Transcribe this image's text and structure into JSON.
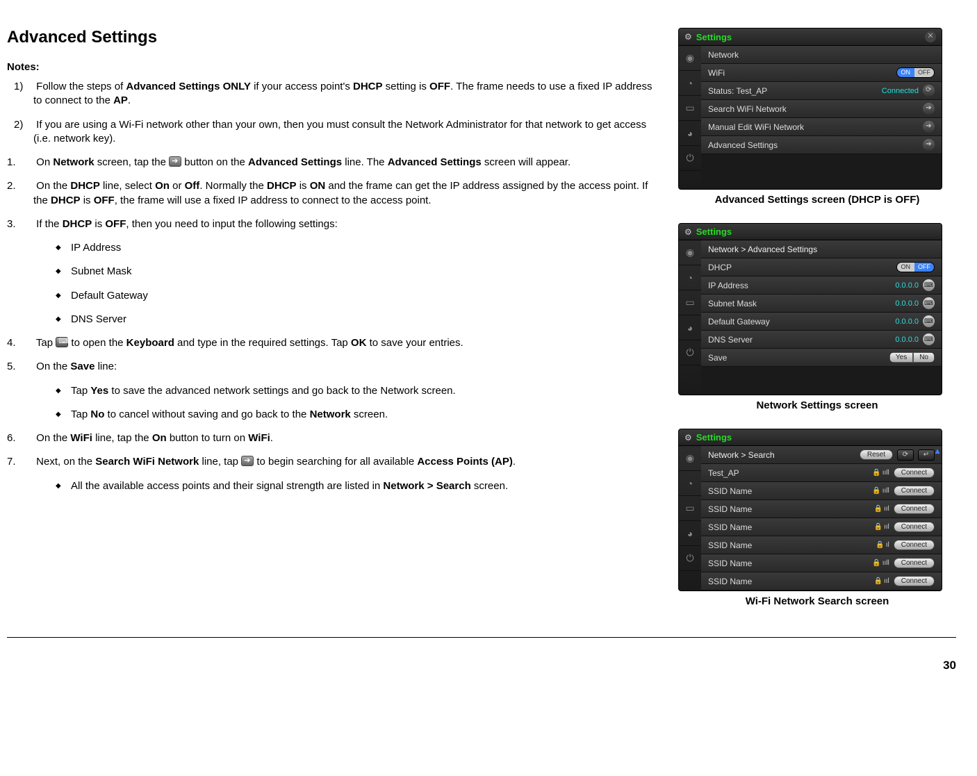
{
  "page": {
    "title": "Advanced Settings",
    "notes_label": "Notes:",
    "page_number": "30"
  },
  "notes": {
    "n1_num": "1)",
    "n1_a": "Follow the steps of ",
    "n1_b": "Advanced Settings ONLY",
    "n1_c": " if your access point's ",
    "n1_d": "DHCP",
    "n1_e": " setting is ",
    "n1_f": "OFF",
    "n1_g": ".  The frame needs to use a fixed IP address to connect to the ",
    "n1_h": "AP",
    "n1_i": ".",
    "n2_num": "2)",
    "n2": "If you are using a Wi-Fi network other than your own, then you must consult the Network Administrator for that network to get access (i.e. network key)."
  },
  "steps": {
    "s1_num": "1.",
    "s1_a": "On ",
    "s1_b": "Network",
    "s1_c": " screen, tap the  ",
    "s1_d": " button on the ",
    "s1_e": "Advanced Settings",
    "s1_f": " line.  The ",
    "s1_g": "Advanced Settings",
    "s1_h": " screen will appear.",
    "s2_num": "2.",
    "s2_a": "On the ",
    "s2_b": "DHCP",
    "s2_c": " line, select ",
    "s2_d": "On",
    "s2_e": " or ",
    "s2_f": "Off",
    "s2_g": ".  Normally the ",
    "s2_h": "DHCP",
    "s2_i": " is ",
    "s2_j": "ON",
    "s2_k": " and the frame can get the IP address assigned by the access point.  If the ",
    "s2_l": "DHCP",
    "s2_m": " is ",
    "s2_n": "OFF",
    "s2_o": ", the frame will use a fixed IP address to connect to the access point.",
    "s3_num": "3.",
    "s3_a": "If the ",
    "s3_b": "DHCP",
    "s3_c": " is ",
    "s3_d": "OFF",
    "s3_e": ", then you need to input the following settings:",
    "b1": "IP Address",
    "b2": "Subnet Mask",
    "b3": "Default Gateway",
    "b4": "DNS Server",
    "s4_num": "4.",
    "s4_a": "Tap ",
    "s4_b": " to open the ",
    "s4_c": "Keyboard",
    "s4_d": " and type in the required settings.  Tap ",
    "s4_e": "OK",
    "s4_f": " to save your entries.",
    "s5_num": "5.",
    "s5_a": "On the ",
    "s5_b": "Save",
    "s5_c": " line:",
    "b5_a": "Tap ",
    "b5_b": "Yes",
    "b5_c": " to save the advanced network settings and go back to the Network screen.",
    "b6_a": "Tap ",
    "b6_b": "No",
    "b6_c": " to cancel without saving and go back to the ",
    "b6_d": "Network",
    "b6_e": " screen.",
    "s6_num": "6.",
    "s6_a": "On the ",
    "s6_b": "WiFi",
    "s6_c": " line, tap the ",
    "s6_d": "On",
    "s6_e": " button to turn on ",
    "s6_f": "WiFi",
    "s6_g": ".",
    "s7_num": "7.",
    "s7_a": "Next, on the ",
    "s7_b": "Search WiFi Network",
    "s7_c": " line, tap ",
    "s7_d": " to begin searching for all available ",
    "s7_e": "Access Points (AP)",
    "s7_f": ".",
    "b7_a": "All the available access points and their signal strength are listed in ",
    "b7_b": "Network > Search",
    "b7_c": " screen."
  },
  "captions": {
    "c1": "Advanced Settings screen (DHCP is OFF)",
    "c2": "Network Settings screen",
    "c3": "Wi-Fi Network Search screen"
  },
  "dev_common": {
    "title": "Settings",
    "close": "✕"
  },
  "dev1": {
    "network_header": "Network",
    "wifi": "WiFi",
    "wifi_on": "ON",
    "wifi_off": "OFF",
    "status": "Status: Test_AP",
    "connected": "Connected",
    "search": "Search WiFi Network",
    "manual": "Manual Edit WiFi Network",
    "adv": "Advanced Settings"
  },
  "dev2": {
    "crumb": "Network > Advanced Settings",
    "dhcp": "DHCP",
    "dhcp_on": "ON",
    "dhcp_off": "OFF",
    "ip": "IP Address",
    "subnet": "Subnet Mask",
    "gateway": "Default Gateway",
    "dns": "DNS Server",
    "val": "0.0.0.0",
    "save": "Save",
    "yes": "Yes",
    "no": "No"
  },
  "dev3": {
    "crumb": "Network > Search",
    "reset": "Reset",
    "ap": "Test_AP",
    "ssid": "SSID Name",
    "connect": "Connect"
  }
}
